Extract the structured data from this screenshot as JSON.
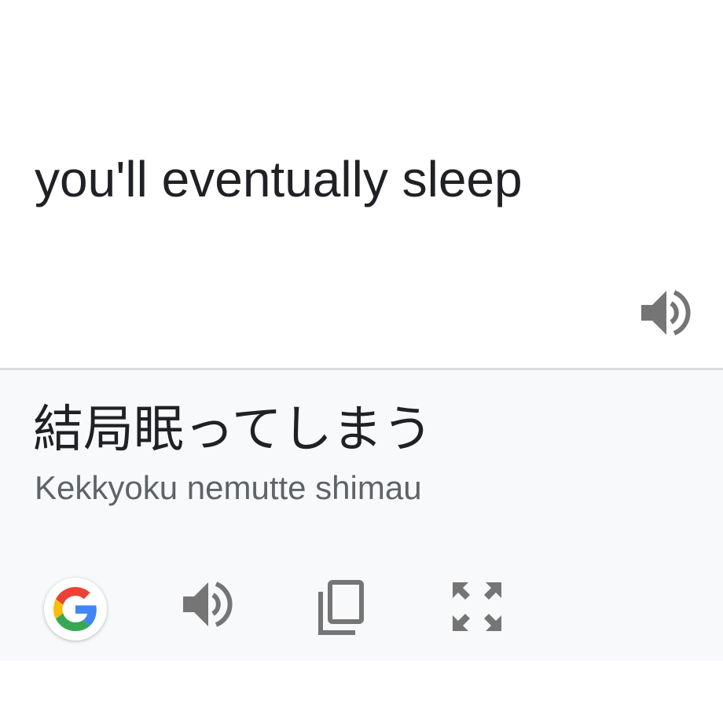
{
  "source": {
    "text": "you'll eventually sleep",
    "speak_icon": "volume-icon"
  },
  "translation": {
    "text": "結局眠ってしまう",
    "romanization": "Kekkyoku nemutte shimau"
  },
  "toolbar": {
    "items": [
      {
        "icon": "google-logo-icon"
      },
      {
        "icon": "volume-icon"
      },
      {
        "icon": "copy-icon"
      },
      {
        "icon": "fullscreen-icon"
      }
    ]
  },
  "colors": {
    "text_primary": "#202124",
    "text_secondary": "#5f6368",
    "icon_gray": "#757575",
    "panel_background": "#f8f9fa",
    "divider": "#dadce0",
    "google_blue": "#4285F4",
    "google_red": "#EA4335",
    "google_yellow": "#FBBC05",
    "google_green": "#34A853"
  }
}
